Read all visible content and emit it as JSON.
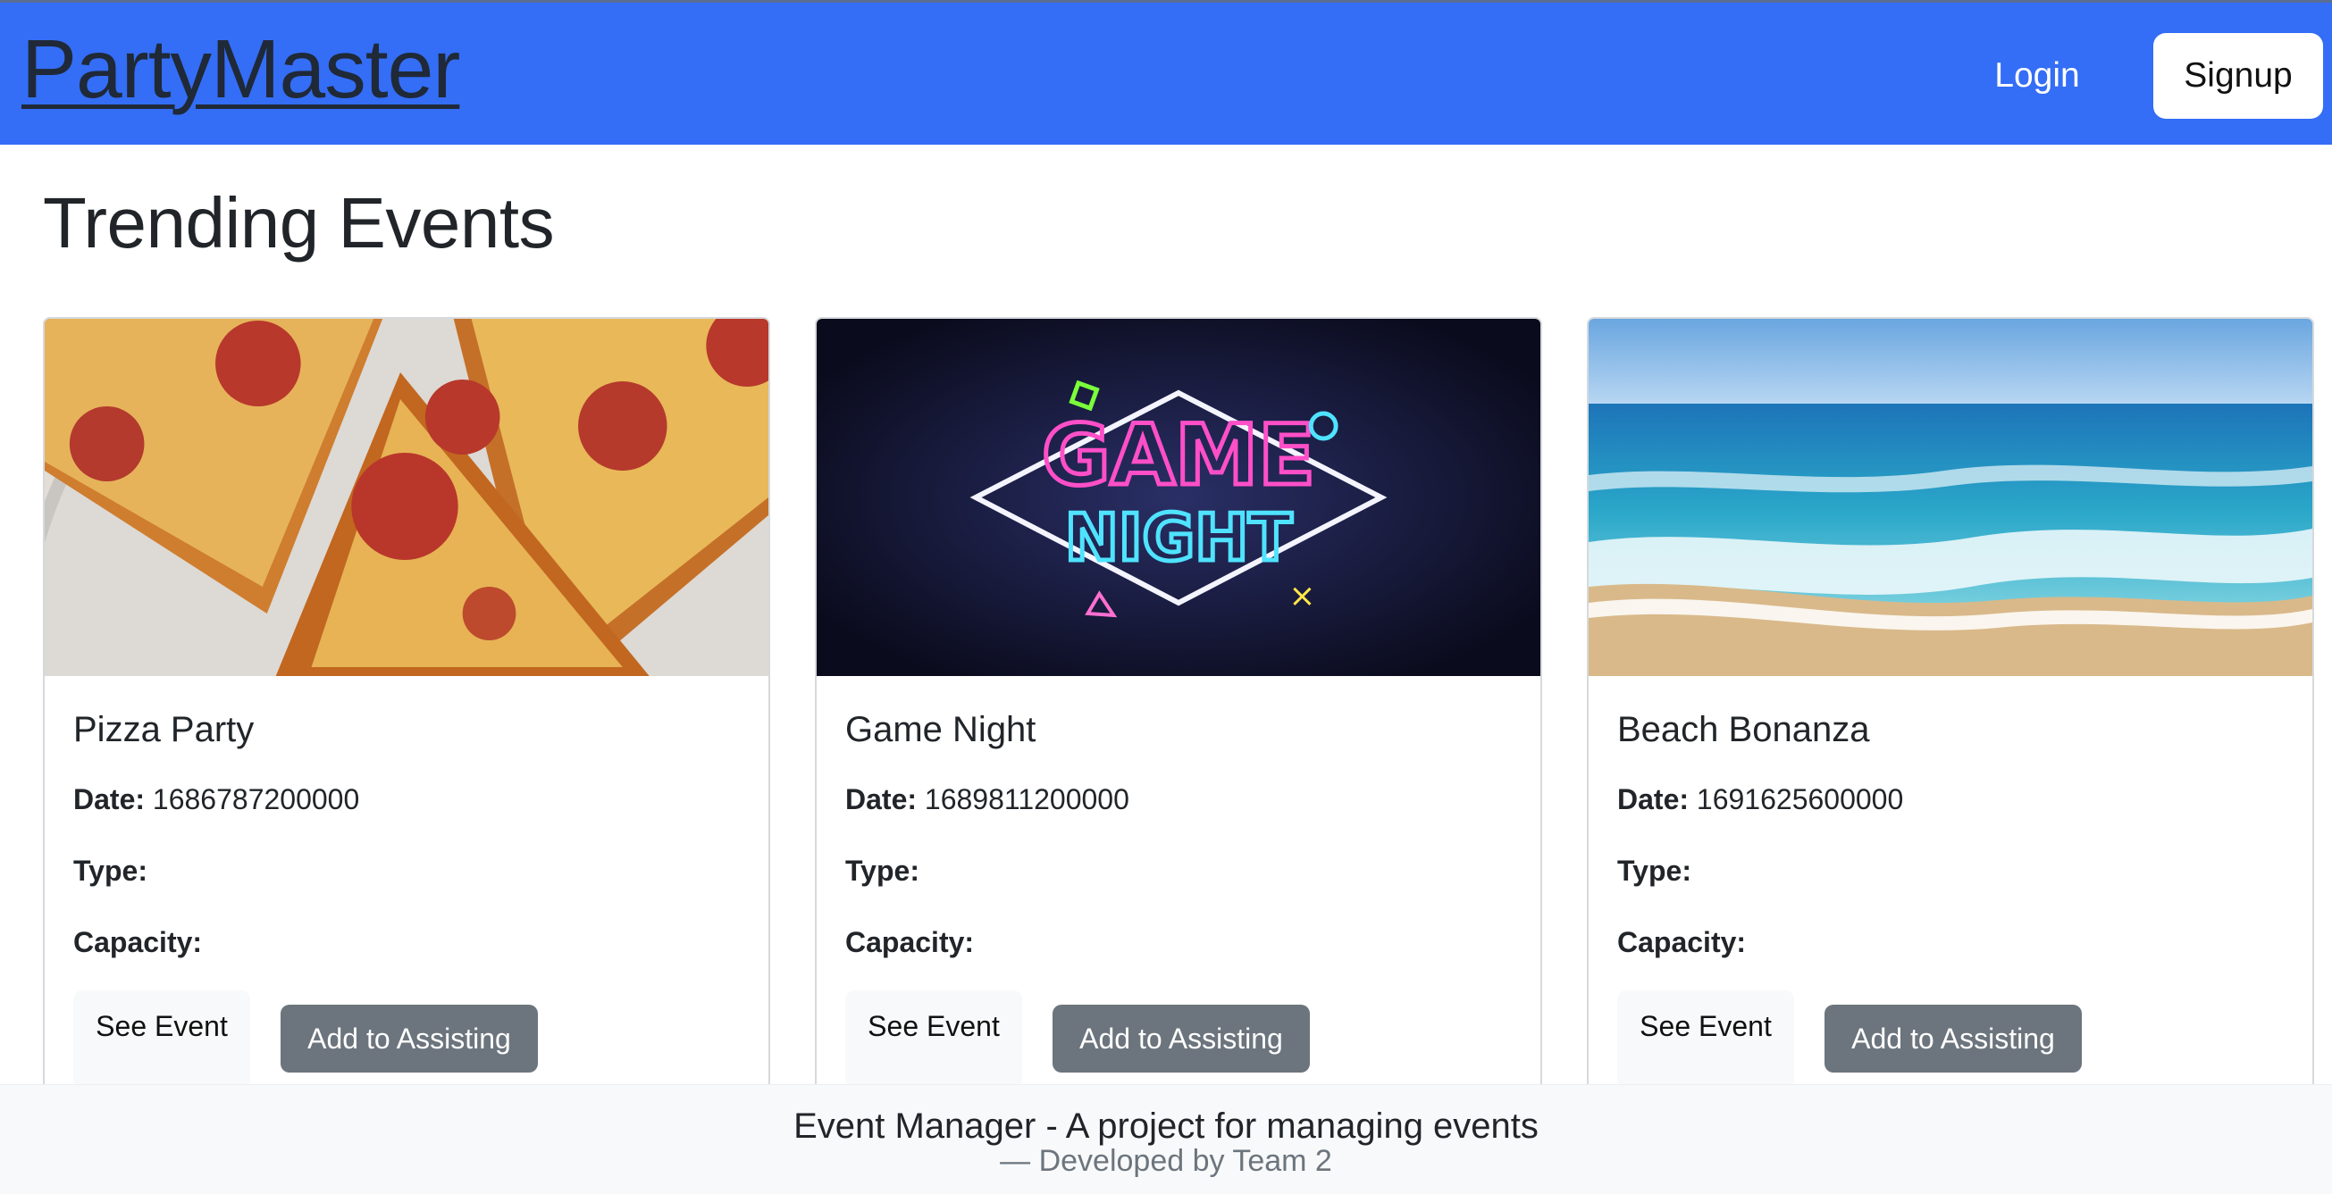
{
  "navbar": {
    "brand": "PartyMaster",
    "login_label": "Login",
    "signup_label": "Signup",
    "color": "#346df6"
  },
  "main": {
    "heading": "Trending Events"
  },
  "labels": {
    "date": "Date:",
    "type": "Type:",
    "capacity": "Capacity:"
  },
  "events": [
    {
      "title": "Pizza Party",
      "date": "1686787200000",
      "type": "",
      "capacity": "",
      "image": "pizza-photo",
      "see_label": "See Event",
      "add_label": "Add to Assisting"
    },
    {
      "title": "Game Night",
      "date": "1689811200000",
      "type": "",
      "capacity": "",
      "image": "game-night-neon-sign",
      "see_label": "See Event",
      "add_label": "Add to Assisting"
    },
    {
      "title": "Beach Bonanza",
      "date": "1691625600000",
      "type": "",
      "capacity": "",
      "image": "beach-photo",
      "see_label": "See Event",
      "add_label": "Add to Assisting"
    }
  ],
  "footer": {
    "main": "Event Manager - A project for managing events",
    "sub": "— Developed by Team 2"
  },
  "colors": {
    "primary_nav": "#346df6",
    "secondary_button": "#6c757d",
    "light_button": "#f8f9fa"
  }
}
